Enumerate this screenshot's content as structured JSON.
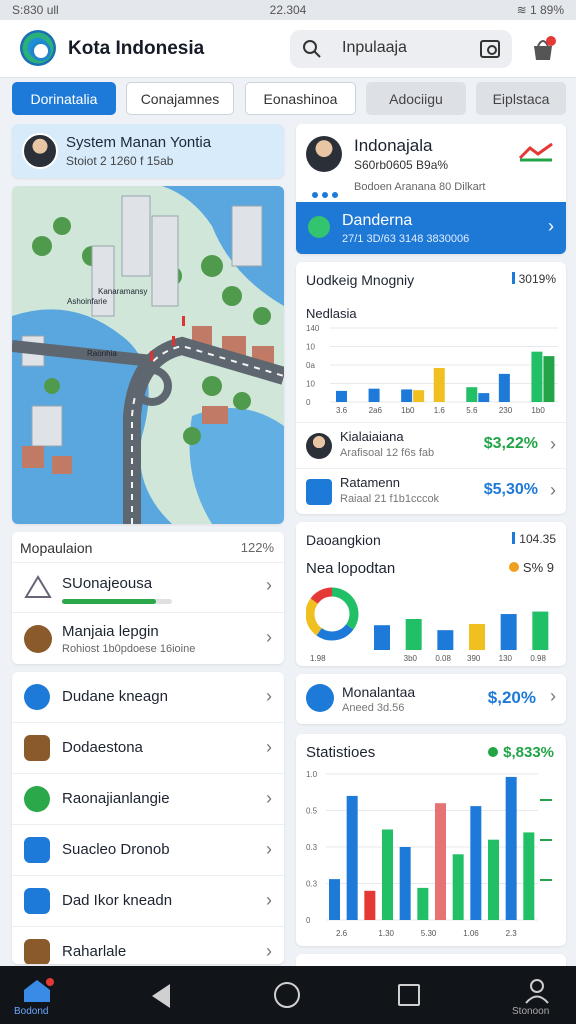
{
  "status_bar": {
    "left": "S:830 ull",
    "time": "22.304",
    "right": "≋ 1 89%"
  },
  "header": {
    "title": "Kota Indonesia",
    "search_value": "Inpulaaja"
  },
  "tabs": [
    {
      "label": "Dorinatalia"
    },
    {
      "label": "Conajamnes"
    },
    {
      "label": "Eonashinoa"
    },
    {
      "label": "Adociigu"
    },
    {
      "label": "Eiplstaca"
    }
  ],
  "user_card": {
    "title": "System Manan Yontia",
    "subtitle": "Stoiot 2 1260 f 15ab"
  },
  "map": {
    "labels": [
      {
        "text": "Kanaramansy"
      },
      {
        "text": "Raonhia"
      },
      {
        "text": "Ashoinfarie"
      }
    ]
  },
  "population": {
    "title": "Mopaulaion",
    "percent": "122%",
    "row1_label": "SUonajeousa",
    "row1_progress": 0.85,
    "row2_label": "Manjaia lepgin",
    "row2_sub": "Rohiost 1b0pdoese 16ioine"
  },
  "menu": [
    {
      "label": "Dudane kneagn",
      "icon": "location-pin-icon",
      "color": "#1e7ad8"
    },
    {
      "label": "Dodaestona",
      "icon": "temple-icon",
      "color": "#8a5a2b"
    },
    {
      "label": "Raonajianlangie",
      "icon": "chat-bubble-icon",
      "color": "#2aa84a"
    },
    {
      "label": "Suacleo Dronob",
      "icon": "list-icon",
      "color": "#1e7ad8"
    },
    {
      "label": "Dad Ikor kneadn",
      "icon": "clipboard-icon",
      "color": "#1e7ad8"
    },
    {
      "label": "Raharlale",
      "icon": "monument-icon",
      "color": "#8a5a2b"
    }
  ],
  "profile": {
    "name": "Indonajala",
    "line2": "S60rb0605 B9a%",
    "line3": "Bodoen Aranana 80 Dilkart",
    "banner_title": "Danderna",
    "banner_sub": "27/1 3D/63 3148 3830006"
  },
  "stats1": {
    "header": "Uodkeig Mnogniy",
    "header_right": "3019%",
    "subtitle": "Nedlasia",
    "row1_title": "Kialaiaiana",
    "row1_sub": "Arafisoal 12 f6s fab",
    "row1_value": "$3,22%",
    "row2_title": "Ratamenn",
    "row2_sub": "Raiaal 21 f1b1cccok",
    "row2_value": "$5,30%"
  },
  "stats2": {
    "header": "Daoangkion",
    "header_right": "104.35",
    "title": "Nea lopodtan",
    "right": "S% 9"
  },
  "growth": {
    "title": "Monalantaa",
    "sub": "Aneed 3d.56",
    "value": "$,20%"
  },
  "stats3": {
    "title": "Statistioes",
    "right": "$,833%"
  },
  "nav": {
    "home_label": "Bodond",
    "profile_label": "Stonoon"
  },
  "chart_data": [
    {
      "type": "bar",
      "title": "Nedlasia",
      "y_ticks": [
        "140",
        "10",
        "0a",
        "10",
        "0"
      ],
      "categories": [
        "3.6",
        "2a6",
        "1b0",
        "1.6",
        "5.6",
        "230",
        "1b0"
      ],
      "series": [
        {
          "values": [
            0.15,
            0.18,
            0.17,
            0.46,
            0.2,
            0.38,
            0.68
          ],
          "colors": [
            "#1e7ad8",
            "#1e7ad8",
            "#1e7ad8",
            "#f0c020",
            "#22c066",
            "#1e7ad8",
            "#22c066"
          ]
        },
        {
          "values": [
            0,
            0,
            0.16,
            0,
            0.12,
            0,
            0.62
          ],
          "colors": [
            "#f0c020",
            "#f0c020",
            "#f0c020",
            "#f0c020",
            "#1e7ad8",
            "#1e7ad8",
            "#22a447"
          ]
        }
      ],
      "ylim": [
        0,
        1
      ]
    },
    {
      "type": "bar",
      "title": "Nea lopodtan",
      "has_donut": true,
      "donut_slices": [
        0.35,
        0.25,
        0.25,
        0.15
      ],
      "donut_colors": [
        "#22c066",
        "#1e7ad8",
        "#f0c020",
        "#e53935"
      ],
      "categories": [
        "1.98",
        "3b0",
        "0.08",
        "390",
        "130",
        "0.98"
      ],
      "values": [
        0.4,
        0.5,
        0.32,
        0.42,
        0.58,
        0.62
      ],
      "colors": [
        "#1e7ad8",
        "#22c066",
        "#1e7ad8",
        "#f0c020",
        "#1e7ad8",
        "#22c066"
      ],
      "ylim": [
        0,
        1
      ]
    },
    {
      "type": "bar",
      "title": "Statistioes",
      "y_ticks": [
        "1.0",
        "0.5",
        "0.3",
        "0.3",
        "0"
      ],
      "categories": [
        "2.6",
        "1.30",
        "5.30",
        "1.06",
        "2.3"
      ],
      "values": [
        0.28,
        0.85,
        0.2,
        0.62,
        0.5,
        0.22,
        0.8,
        0.45,
        0.78,
        0.55,
        0.98,
        0.6
      ],
      "colors": [
        "#1e7ad8",
        "#1e7ad8",
        "#e53935",
        "#22c066",
        "#1e7ad8",
        "#22c066",
        "#e57373",
        "#22c066",
        "#1e7ad8",
        "#22c066",
        "#1e7ad8",
        "#22c066"
      ],
      "ylim": [
        0,
        1
      ]
    }
  ]
}
